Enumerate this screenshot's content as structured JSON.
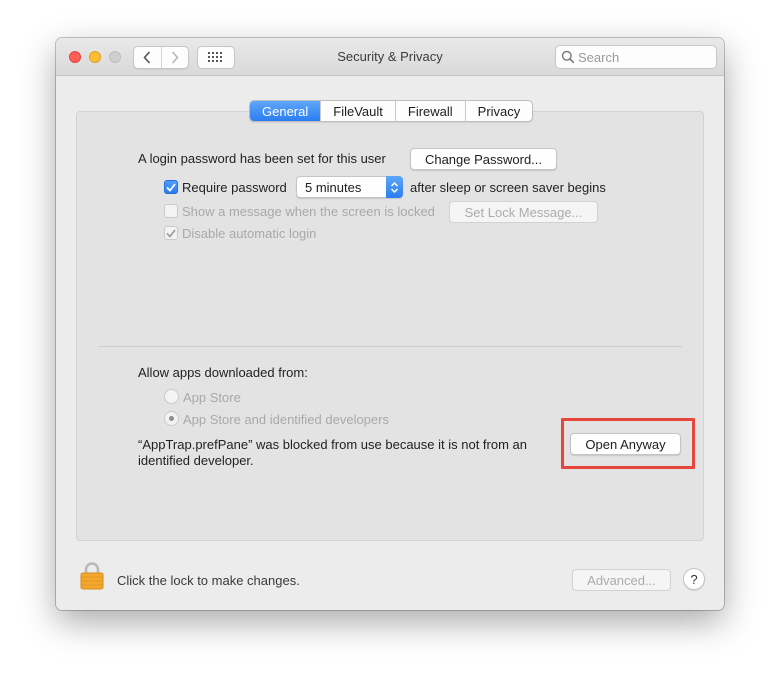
{
  "window": {
    "title": "Security & Privacy",
    "search_placeholder": "Search"
  },
  "tabs": [
    {
      "label": "General",
      "active": true
    },
    {
      "label": "FileVault",
      "active": false
    },
    {
      "label": "Firewall",
      "active": false
    },
    {
      "label": "Privacy",
      "active": false
    }
  ],
  "general": {
    "login_password_text": "A login password has been set for this user",
    "change_password_label": "Change Password...",
    "require_password_label": "Require password",
    "require_password_checked": true,
    "require_password_delay": "5 minutes",
    "after_sleep_text": "after sleep or screen saver begins",
    "show_message_label": "Show a message when the screen is locked",
    "show_message_checked": false,
    "set_lock_message_label": "Set Lock Message...",
    "disable_auto_login_label": "Disable automatic login",
    "disable_auto_login_checked": true
  },
  "apps": {
    "heading": "Allow apps downloaded from:",
    "options": [
      {
        "label": "App Store",
        "selected": false
      },
      {
        "label": "App Store and identified developers",
        "selected": true
      }
    ],
    "blocked_message_line1": "“AppTrap.prefPane” was blocked from use because it is not from an",
    "blocked_message_line2": "identified developer.",
    "open_anyway_label": "Open Anyway"
  },
  "footer": {
    "lock_text": "Click the lock to make changes.",
    "advanced_label": "Advanced...",
    "help_label": "?"
  },
  "colors": {
    "accent": "#2b7ef2",
    "highlight": "#e8463c",
    "lock": "#f0a830"
  }
}
